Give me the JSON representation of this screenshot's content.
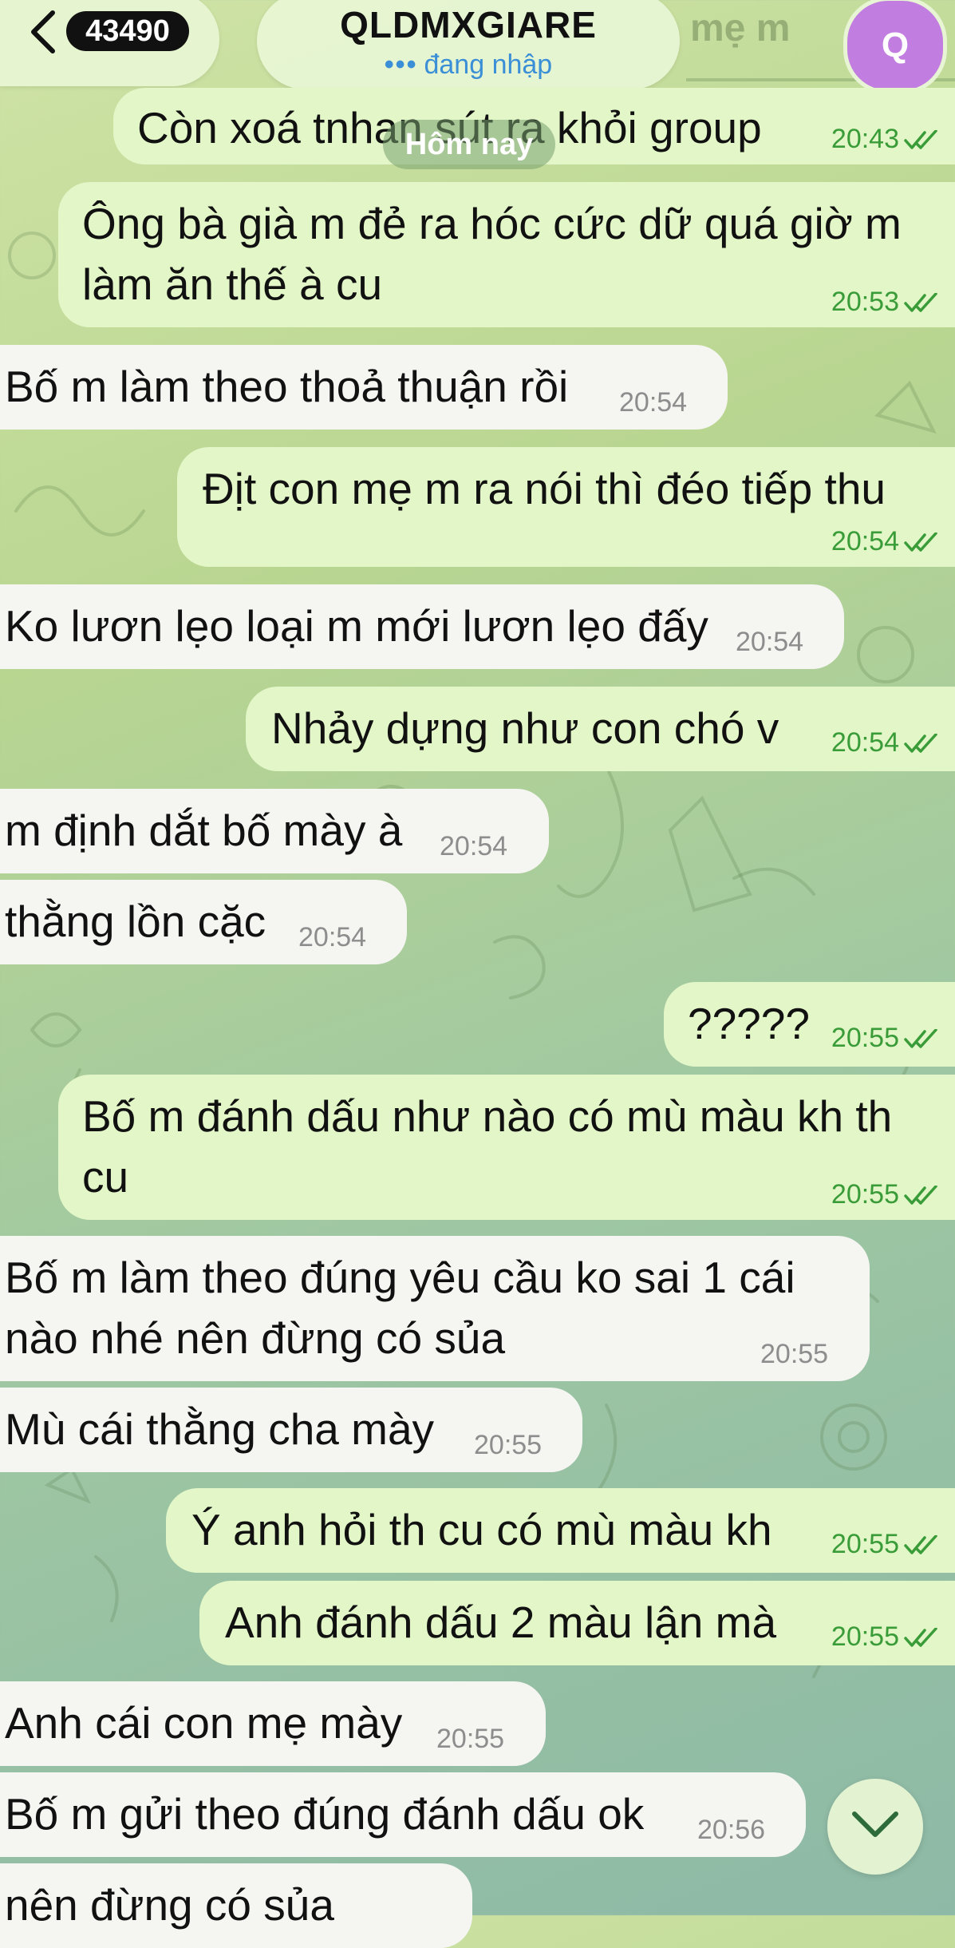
{
  "header": {
    "unread_count": "43490",
    "chat_title": "QLDMXGIARE",
    "status_text": "đang nhập",
    "avatar_letter": "Q",
    "obscured_text": "mẹ m"
  },
  "date_separator": "Hôm nay",
  "messages": [
    {
      "dir": "out",
      "lines": [
        "Còn xoá tnhan sút ra khỏi group"
      ],
      "time": "20:43",
      "read": true
    },
    {
      "dir": "out",
      "lines": [
        "Ông bà già m đẻ ra hóc cức dữ quá giờ m",
        "làm ăn thế à cu"
      ],
      "time": "20:53",
      "read": true
    },
    {
      "dir": "in",
      "lines": [
        "Bố m làm theo thoả thuận rồi"
      ],
      "time": "20:54"
    },
    {
      "dir": "out",
      "lines": [
        "Địt con mẹ m ra nói thì đéo tiếp thu"
      ],
      "time": "20:54",
      "read": true
    },
    {
      "dir": "in",
      "lines": [
        "Ko lươn lẹo loại m mới lươn lẹo đấy"
      ],
      "time": "20:54"
    },
    {
      "dir": "out",
      "lines": [
        "Nhảy dựng như con chó v"
      ],
      "time": "20:54",
      "read": true
    },
    {
      "dir": "in",
      "lines": [
        "m định dắt bố mày à"
      ],
      "time": "20:54"
    },
    {
      "dir": "in",
      "lines": [
        "thằng lồn cặc"
      ],
      "time": "20:54"
    },
    {
      "dir": "out",
      "lines": [
        "?????"
      ],
      "time": "20:55",
      "read": true
    },
    {
      "dir": "out",
      "lines": [
        "Bố m đánh dấu như nào có mù màu kh th",
        "cu"
      ],
      "time": "20:55",
      "read": true
    },
    {
      "dir": "in",
      "lines": [
        "Bố m làm theo đúng yêu cầu ko sai 1 cái",
        "nào nhé nên đừng có sủa"
      ],
      "time": "20:55"
    },
    {
      "dir": "in",
      "lines": [
        "Mù cái thằng cha mày"
      ],
      "time": "20:55"
    },
    {
      "dir": "out",
      "lines": [
        "Ý anh hỏi th cu có mù màu kh"
      ],
      "time": "20:55",
      "read": true
    },
    {
      "dir": "out",
      "lines": [
        "Anh đánh dấu 2 màu lận mà"
      ],
      "time": "20:55",
      "read": true
    },
    {
      "dir": "in",
      "lines": [
        "Anh cái con mẹ mày"
      ],
      "time": "20:55"
    },
    {
      "dir": "in",
      "lines": [
        "Bố m gửi theo đúng đánh dấu ok"
      ],
      "time": "20:56"
    },
    {
      "dir": "in",
      "lines": [
        "nên đừng có sủa"
      ],
      "time": ""
    }
  ],
  "icons": {
    "back": "chevron-left-icon",
    "scroll": "chevron-down-icon",
    "read_receipt": "double-check-icon"
  }
}
